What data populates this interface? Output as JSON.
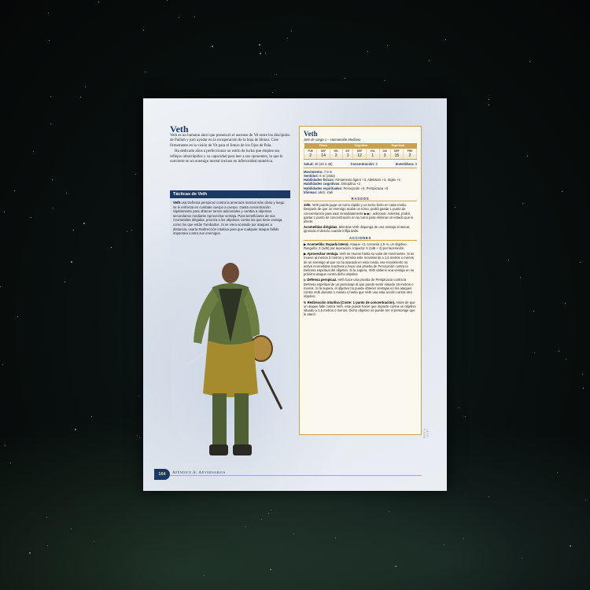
{
  "monster": {
    "title": "Veth",
    "intro_p1": "Veth es un humano alezí que presenció el ascenso de Yit entre los discípulos de Pailiah y juró ayudar en la recuperación de la hoja de Honor. Cree firmemente en la visión de Yit para el futuro de los Ojos de Pala.",
    "intro_p2": "Ha dedicado años a perfeccionar un estilo de lucha que emplea sus reflejos ultrarrápidos y su capacidad para leer a sus oponentes, lo que le convierte en un enemigo mortal incluso en inferioridad numérica."
  },
  "tactics": {
    "heading": "Tácticas de Veth",
    "name": "Veth",
    "text": " usa Defensa perspicaz contra la amenaza marcial más obvia y luego se le enfrenta en combate cuerpo a cuerpo. Gasta concentración rápidamente para obtener turnos adicionales y cambia a objetivos secundarios mediante Aprovechar ventaja. Para beneficiarse de sus Acometidas dirigidas, prioriza a los objetivos contra los que tiene ventaja, como los que están Tumbados. Si se viera acosado por ataques a distancia, usaría Redirección intuitiva para que cualquier ataque fallido impactara contra sus enemigos."
  },
  "stat_block": {
    "name": "Veth",
    "subtitle": "Jefe de rango 1 – Humanoide Mediano",
    "groups": [
      "Física",
      "Cognitiva",
      "Espiritual"
    ],
    "abbr": [
      "FUE",
      "DEF",
      "VEL",
      "INT",
      "DEF",
      "VOL",
      "DIS",
      "DEF",
      "PRE"
    ],
    "values": [
      "2",
      "14",
      "2",
      "1",
      "12",
      "1",
      "3",
      "15",
      "2"
    ],
    "health_label": "Salud:",
    "health_value": "40 (32 a 48)",
    "focus_label": "Concentración:",
    "focus_value": "3",
    "investiture_label": "Investidura:",
    "investiture_value": "0",
    "movement_label": "Movimiento:",
    "movement_value": "7,5 m",
    "senses_label": "Sentidos:",
    "senses_value": "6 m (vista)",
    "phys_label": "Habilidades físicas:",
    "phys_value": "Armamento ligero +3, Atletismo +3, Sigilo +4",
    "cog_label": "Habilidades cognitivas:",
    "cog_value": "Disciplina +3",
    "spir_label": "Habilidades espirituales:",
    "spir_value": "Percepción +5, Perspicacia +5",
    "lang_label": "Idiomas:",
    "lang_value": "alezí, iriali",
    "traits_heading": "Rasgos",
    "trait1_name": "Jefe.",
    "trait1_text": " Veth puede jugar un turno rápido y un turno lento en cada ronda. Después de que un enemigo acabe un turno, podrá gastar 1 punto de concentración para usar inmediatamente ▶◆▷ adicional. Además, podrá gastar 1 punto de concentración en su turno para eliminar un estado que le afecte.",
    "trait2_name": "Acometidas dirigidas.",
    "trait2_text": " Mientras Veth disponga de una ventaja al atacar, ignorará el desvío cuando inflija daño.",
    "actions_heading": "Acciones",
    "action1_name": "Acometida: Espada lateral.",
    "action1_text": " Ataque +3, cercanía 1,5 m, un objetivo. Rasguño: 3 (1d6) por laceración. Impacto: 6 (1d6 + 3) por laceración.",
    "action2_name": "Aprovechar ventaja.",
    "action2_text": " Veth se mueve hasta su valor de movimiento. Si se mueve al menos 3 metros y termina este movimiento a 1,5 metros o menos de un enemigo al que no ha atacado en esta ronda, ese movimiento no activa Acometidas reactivas y hace una prueba de Percepción contra la Defensa espiritual del objetivo. Si la supera, Veth obtiene una ventaja en su próximo ataque contra dicho objetivo.",
    "action3_name": "Defensa perspicaz.",
    "action3_text": " Veth hace una prueba de Perspicacia contra la Defensa espiritual de un personaje al que puede sentir situado 18 metros o menos. Si la supera, el objetivo no puede obtener ventajas en los ataques contra Veth durante 1 minuto o hasta que Veth usa esta acción contra otro objetivo.",
    "action4_name": "Redirección intuitiva (Coste: 1 punto de concentración).",
    "action4_text": " Antes de que un ataque falle contra Veth, este puede hacer que impacte contra un objetivo situado a 1,5 metros o menos. Dicho objetivo no puede ser el personaje que le atacó."
  },
  "footer": {
    "page_number": "164",
    "section_title": "Apéndice A: Adversarios",
    "side_label": "VETH FIGHA"
  },
  "colors": {
    "navy": "#1c3966",
    "gold": "#c9a24f"
  }
}
